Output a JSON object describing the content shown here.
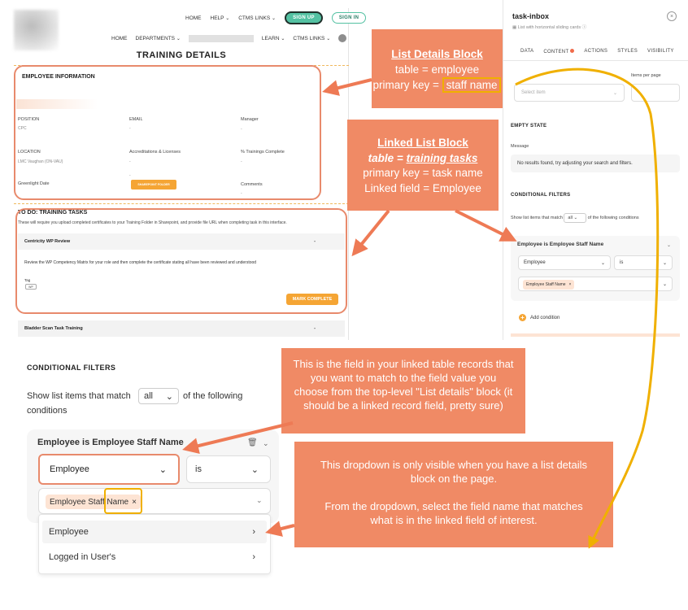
{
  "nav_top": {
    "home": "HOME",
    "help": "HELP",
    "ctms_links": "CTMS LINKS",
    "sign_up": "SIGN UP",
    "sign_in": "SIGN IN"
  },
  "nav_second": {
    "home": "HOME",
    "departments": "DEPARTMENTS",
    "learn": "LEARN",
    "ctms_links": "CTMS LINKS"
  },
  "page_title": "TRAINING DETAILS",
  "employee_info": {
    "heading": "EMPLOYEE INFORMATION",
    "position_label": "POSITION",
    "position_value": "CPC",
    "email_label": "EMAIL",
    "email_value": "-",
    "manager_label": "Manager",
    "manager_value": "-",
    "location_label": "LOCATION",
    "location_value": "LMC Vaughan (ON-VAU)",
    "accreditations_label": "Accreditations & Licenses",
    "accreditations_value": "-",
    "trainings_label": "% Trainings Complete",
    "trainings_value": "-",
    "greenlight_label": "Greenlight Date",
    "greenlight_value": "-",
    "sharepoint_button": "SHAREPOINT FOLDER",
    "comments_label": "Comments",
    "comments_value": "-"
  },
  "tasks": {
    "heading": "TO DO: TRAINING TASKS",
    "description": "These will require you upload completed certificates to your Training Folder in Sharepoint, and provide file URL when completing task in this interface.",
    "task1_name": "Centricity WP Review",
    "task1_value": "-",
    "task1_text": "Review the WP Competency Matrix for your role and then complete the certificate stating all have been reviewed and understood",
    "tag_label": "Tag",
    "tag_value": "WP",
    "mark_complete": "MARK COMPLETE",
    "task2_name": "Bladder Scan Task Training",
    "task2_value": "-"
  },
  "panel": {
    "title": "task-inbox",
    "subtitle": "List with horizontal sliding cards",
    "tabs": [
      "DATA",
      "CONTENT",
      "ACTIONS",
      "STYLES",
      "VISIBILITY"
    ],
    "select_placeholder": "Select item",
    "items_per_page": "Items per page",
    "empty_state_heading": "EMPTY STATE",
    "message_label": "Message",
    "message_value": "No results found, try adjusting your search and filters.",
    "cond_heading": "CONDITIONAL FILTERS",
    "show_prefix": "Show list items that match",
    "match_value": "all",
    "show_suffix": "of the following conditions",
    "condition_title": "Employee is Employee Staff Name",
    "field_value": "Employee",
    "operator_value": "is",
    "chip_value": "Employee Staff Name",
    "add_condition": "Add condition"
  },
  "zoom": {
    "heading": "CONDITIONAL FILTERS",
    "show_prefix": "Show list items that match",
    "match_value": "all",
    "show_suffix": "of the following",
    "show_suffix2": "conditions",
    "condition_title": "Employee is Employee Staff Name",
    "field_value": "Employee",
    "operator_value": "is",
    "chip_value": "Employee Staff Name",
    "menu_items": [
      "Employee",
      "Logged in User's"
    ]
  },
  "callouts": {
    "list_details_title": "List Details Block",
    "list_details_line1": "table = employee",
    "list_details_line2_prefix": "primary key = ",
    "list_details_line2_key": "staff name",
    "linked_title": "Linked List Block",
    "linked_line1_prefix": "table = ",
    "linked_line1_value": "training tasks",
    "linked_line2": "primary key = task name",
    "linked_line3": "Linked field = Employee",
    "field_note": "This is the field in your linked table records that you want to match to the field value you choose from the top-level \"List details\" block (it should be a linked record field, pretty sure)",
    "dropdown_note_p1": "This dropdown is only visible when you have a list details block on the page.",
    "dropdown_note_p2": "From the dropdown, select the field name that matches what is in the linked field of interest."
  },
  "colors": {
    "callout": "#f08a65",
    "highlight": "#f0b000",
    "accent_orange": "#f5a534",
    "signup_green": "#53c1a2"
  }
}
